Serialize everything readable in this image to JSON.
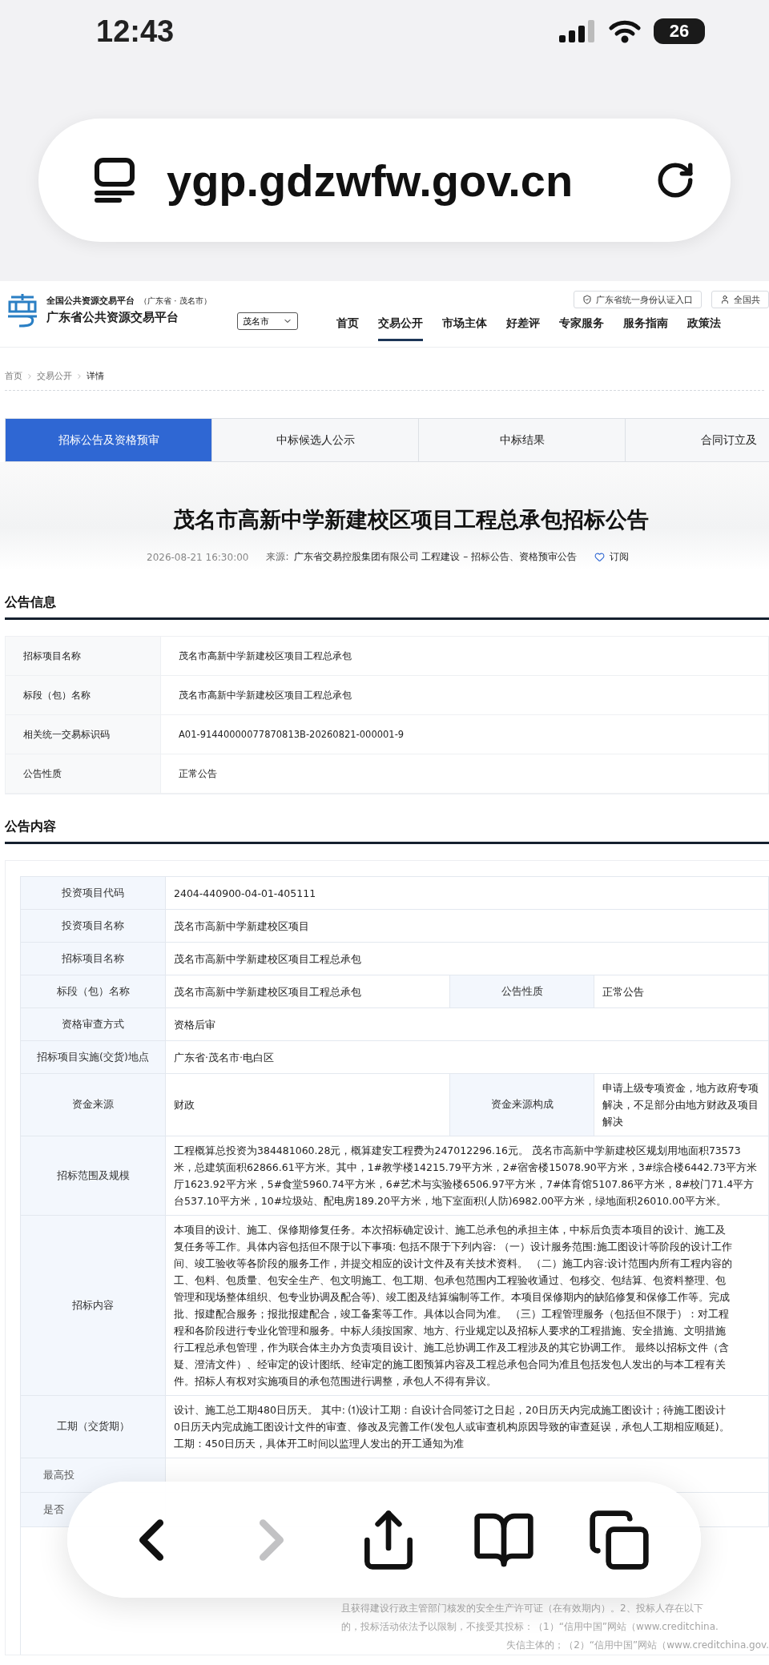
{
  "status_bar": {
    "time": "12:43",
    "battery": "26"
  },
  "url_bar": {
    "url": "ygp.gdzwfw.gov.cn"
  },
  "site_header": {
    "platform_name": "全国公共资源交易平台",
    "region_note": "（广东省 · 茂名市）",
    "site_name": "广东省公共资源交易平台",
    "city_select": "茂名市",
    "top_links": [
      {
        "kind": "shield",
        "label": "广东省统一身份认证入口"
      },
      {
        "kind": "user",
        "label": "全国共"
      }
    ],
    "nav": [
      {
        "label": "首页",
        "selected": false
      },
      {
        "label": "交易公开",
        "selected": true
      },
      {
        "label": "市场主体",
        "selected": false
      },
      {
        "label": "好差评",
        "selected": false
      },
      {
        "label": "专家服务",
        "selected": false
      },
      {
        "label": "服务指南",
        "selected": false
      },
      {
        "label": "政策法",
        "selected": false
      }
    ]
  },
  "breadcrumb": [
    "首页",
    "交易公开",
    "详情"
  ],
  "tabs": [
    {
      "label": "招标公告及资格预审",
      "selected": true
    },
    {
      "label": "中标候选人公示",
      "selected": false
    },
    {
      "label": "中标结果",
      "selected": false
    },
    {
      "label": "合同订立及",
      "selected": false
    }
  ],
  "notice": {
    "title": "茂名市高新中学新建校区项目工程总承包招标公告",
    "date": "2026-08-21 16:30:00",
    "source_label": "来源:",
    "source": "广东省交易控股集团有限公司 工程建设 – 招标公告、资格预审公告",
    "subscribe": "订阅"
  },
  "info_section": {
    "heading": "公告信息",
    "rows": [
      {
        "label": "招标项目名称",
        "value": "茂名市高新中学新建校区项目工程总承包"
      },
      {
        "label": "标段（包）名称",
        "value": "茂名市高新中学新建校区项目工程总承包"
      },
      {
        "label": "相关统一交易标识码",
        "value": "A01-91440000077870813B-20260821-000001-9"
      },
      {
        "label": "公告性质",
        "value": "正常公告"
      }
    ]
  },
  "content_section": {
    "heading": "公告内容",
    "rows": [
      {
        "kind": "single",
        "label": "投资项目代码",
        "lines": [
          "2404-440900-04-01-405111"
        ]
      },
      {
        "kind": "single",
        "label": "投资项目名称",
        "lines": [
          "茂名市高新中学新建校区项目"
        ]
      },
      {
        "kind": "single",
        "label": "招标项目名称",
        "lines": [
          "茂名市高新中学新建校区项目工程总承包"
        ]
      },
      {
        "kind": "pair",
        "label": "标段（包）名称",
        "lines": [
          "茂名市高新中学新建校区项目工程总承包"
        ],
        "label_2": "公告性质",
        "lines_2": [
          "正常公告"
        ]
      },
      {
        "kind": "single",
        "label": "资格审查方式",
        "lines": [
          "资格后审"
        ]
      },
      {
        "kind": "single",
        "label": "招标项目实施(交货)地点",
        "lines": [
          "广东省·茂名市·电白区"
        ]
      },
      {
        "kind": "pair",
        "label": "资金来源",
        "lines": [
          "财政"
        ],
        "label_2": "资金来源构成",
        "lines_2": [
          "申请上级专项资金，地方政府专项",
          "解决，不足部分由地方财政及项目",
          "解决"
        ]
      },
      {
        "kind": "single",
        "label": "招标范围及规模",
        "lines": [
          "工程概算总投资为384481060.28元，概算建安工程费为247012296.16元。 茂名市高新中学新建校区规划用地面积73573",
          "米，总建筑面积62866.61平方米。其中，1#教学楼14215.79平方米，2#宿舍楼15078.90平方米，3#综合楼6442.73平方米",
          "厅1623.92平方米，5#食堂5960.74平方米，6#艺术与实验楼6506.97平方米，7#体育馆5107.86平方米，8#校门71.4平方",
          "台537.10平方米，10#垃圾站、配电房189.20平方米，地下室面积(人防)6982.00平方米，绿地面积26010.00平方米。"
        ]
      },
      {
        "kind": "single",
        "label": "招标内容",
        "lines": [
          "本项目的设计、施工、保修期修复任务。本次招标确定设计、施工总承包的承担主体，中标后负责本项目的设计、施工及",
          "复任务等工作。具体内容包括但不限于以下事项: 包括不限于下列内容: （一）设计服务范围:施工图设计等阶段的设计工作",
          "间、竣工验收等各阶段的服务工作，并提交相应的设计文件及有关技术资料。 （二）施工内容:设计范围内所有工程内容的",
          "工、包料、包质量、包安全生产、包文明施工、包工期、包承包范围内工程验收通过、包移交、包结算、包资料整理、包",
          "管理和现场整体组织、包专业协调及配合等)、竣工图及结算编制等工作。本项目保修期内的缺陷修复和保修工作等。完成",
          "批、报建配合服务；报批报建配合，竣工备案等工作。具体以合同为准。 （三）工程管理服务（包括但不限于）：对工程",
          "程和各阶段进行专业化管理和服务。中标人须按国家、地方、行业规定以及招标人要求的工程措施、安全措施、文明措施",
          "行工程总承包管理，作为联合体主办方负责项目设计、施工总协调工作及工程涉及的其它协调工作。 最终以招标文件（含",
          "疑、澄清文件）、经审定的设计图纸、经审定的施工图预算内容及工程总承包合同为准且包括发包人发出的与本工程有关",
          "件。招标人有权对实施项目的承包范围进行调整，承包人不得有异议。"
        ]
      },
      {
        "kind": "single",
        "label": "工期（交货期）",
        "lines": [
          "设计、施工总工期480日历天。 其中: ⑴设计工期：自设计合同签订之日起，20日历天内完成施工图设计；待施工图设计",
          "0日历天内完成施工图设计文件的审查、修改及完善工作(发包人或审查机构原因导致的审查延误，承包人工期相应顺延)。",
          "工期：450日历天，具体开工时间以监理人发出的开工通知为准"
        ]
      },
      {
        "kind": "covered",
        "label": "最高投"
      },
      {
        "kind": "covered",
        "label": "是否"
      },
      {
        "kind": "faded",
        "lines": [
          "且获得建设行政主管部门核发的安全生产许可证（在有效期内）。2、投标人存在以下",
          "的，投标活动依法予以限制，不接受其投标：（1）“信用中国”网站（www.creditchina.",
          "失信主体的；（2）“信用中国”网站（www.creditchina.gov."
        ]
      }
    ]
  },
  "toolbar": [
    {
      "kind": "back",
      "disabled": false
    },
    {
      "kind": "forward",
      "disabled": true
    },
    {
      "kind": "share",
      "disabled": false
    },
    {
      "kind": "bookmarks",
      "disabled": false
    },
    {
      "kind": "tabs",
      "disabled": false
    }
  ]
}
